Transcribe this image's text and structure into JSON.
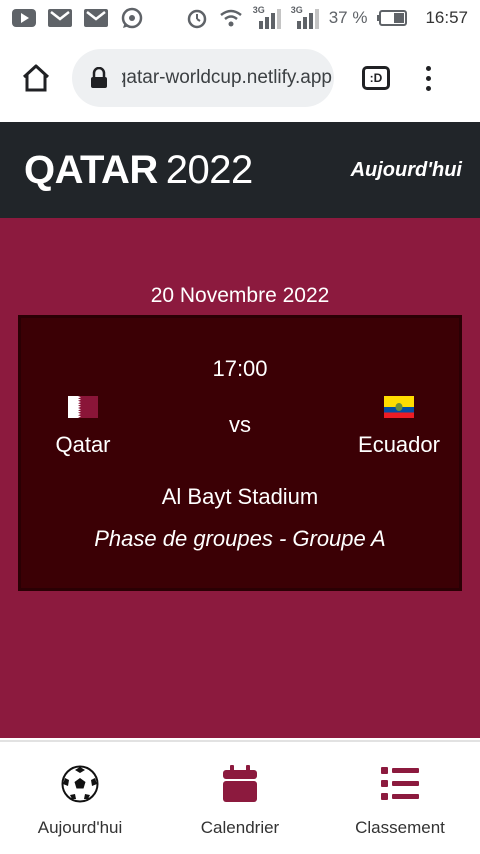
{
  "status_bar": {
    "icons_left": [
      "youtube-icon",
      "gmail-icon",
      "gmail-icon",
      "whatsapp-icon"
    ],
    "icons_right": [
      "alarm-icon",
      "wifi-icon",
      "signal-3g-icon",
      "signal-3g-icon",
      "battery-icon"
    ],
    "network_label_1": "3G",
    "network_label_2": "3G",
    "battery": "37 %",
    "time": "16:57"
  },
  "browser": {
    "url": "qatar-worldcup.netlify.app",
    "tab_label": ":D"
  },
  "header": {
    "brand_bold": "QATAR",
    "brand_year": "2022",
    "nav_link": "Aujourd'hui"
  },
  "match": {
    "date": "20 Novembre 2022",
    "time": "17:00",
    "home_team": "Qatar",
    "away_team": "Ecuador",
    "vs": "vs",
    "stadium": "Al Bayt Stadium",
    "phase": "Phase de groupes - Groupe A"
  },
  "bottom_nav": {
    "items": [
      {
        "label": "Aujourd'hui",
        "icon": "soccer-ball-icon"
      },
      {
        "label": "Calendrier",
        "icon": "calendar-icon"
      },
      {
        "label": "Classement",
        "icon": "list-icon"
      }
    ]
  },
  "colors": {
    "header_bg": "#212529",
    "main_bg": "#8c1a3e",
    "card_bg": "#3b0005",
    "accent": "#8c1a3e"
  }
}
